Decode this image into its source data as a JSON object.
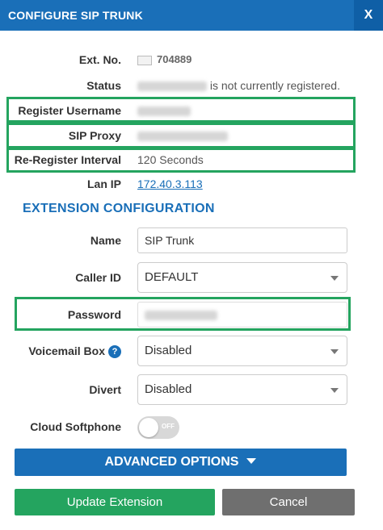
{
  "dialog": {
    "title": "CONFIGURE SIP TRUNK",
    "close_label": "X"
  },
  "fields": {
    "ext_no": {
      "label": "Ext. No.",
      "value": "704889"
    },
    "status": {
      "label": "Status",
      "value": "is not currently registered."
    },
    "register_username": {
      "label": "Register Username"
    },
    "sip_proxy": {
      "label": "SIP Proxy"
    },
    "reregister_interval": {
      "label": "Re-Register Interval",
      "value": "120 Seconds"
    },
    "lan_ip": {
      "label": "Lan IP",
      "value": "172.40.3.113"
    }
  },
  "extension": {
    "section_title": "EXTENSION CONFIGURATION",
    "name": {
      "label": "Name",
      "value": "SIP Trunk"
    },
    "caller_id": {
      "label": "Caller ID",
      "value": "DEFAULT"
    },
    "password": {
      "label": "Password"
    },
    "voicemail_box": {
      "label": "Voicemail Box",
      "value": "Disabled",
      "help": "?"
    },
    "divert": {
      "label": "Divert",
      "value": "Disabled"
    },
    "cloud_softphone": {
      "label": "Cloud Softphone",
      "toggle_text": "OFF"
    }
  },
  "buttons": {
    "advanced": "ADVANCED OPTIONS",
    "update": "Update Extension",
    "cancel": "Cancel"
  },
  "colors": {
    "header": "#1a6fb8",
    "highlight": "#24a45f",
    "primary_action": "#24a45f",
    "secondary_action": "#6f6f6f"
  }
}
